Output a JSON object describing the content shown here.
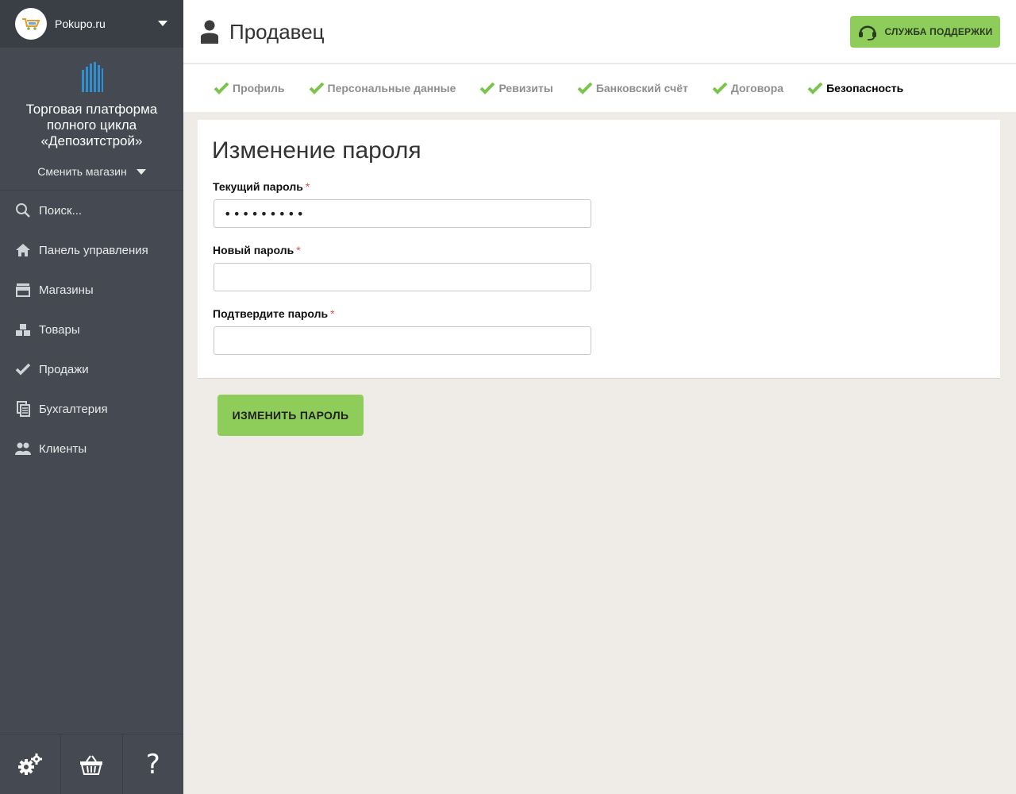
{
  "store": {
    "name": "Pokupo.ru"
  },
  "platform": {
    "name": "Торговая платформа полного цикла «Депозитстрой»",
    "switch_label": "Сменить магазин"
  },
  "nav": [
    {
      "label": "Поиск...",
      "icon": "search-icon"
    },
    {
      "label": "Панель управления",
      "icon": "home-icon"
    },
    {
      "label": "Магазины",
      "icon": "store-icon"
    },
    {
      "label": "Товары",
      "icon": "boxes-icon"
    },
    {
      "label": "Продажи",
      "icon": "check-icon"
    },
    {
      "label": "Бухгалтерия",
      "icon": "documents-icon"
    },
    {
      "label": "Клиенты",
      "icon": "users-icon"
    }
  ],
  "bottom_bar": {
    "help_glyph": "?"
  },
  "header": {
    "title": "Продавец",
    "support_label": "СЛУЖБА ПОДДЕРЖКИ"
  },
  "tabs": [
    {
      "label": "Профиль",
      "active": false
    },
    {
      "label": "Персональные данные",
      "active": false
    },
    {
      "label": "Ревизиты",
      "active": false
    },
    {
      "label": "Банковский счёт",
      "active": false
    },
    {
      "label": "Договора",
      "active": false
    },
    {
      "label": "Безопасность",
      "active": true
    }
  ],
  "form": {
    "title": "Изменение пароля",
    "current_password_label": "Текущий пароль",
    "current_password_value": "•••••••••",
    "new_password_label": "Новый пароль",
    "new_password_value": "",
    "confirm_password_label": "Подтвердите пароль",
    "confirm_password_value": "",
    "required_mark": "*",
    "submit_label": "ИЗМЕНИТЬ ПАРОЛЬ"
  },
  "colors": {
    "accent": "#8fcd5b",
    "sidebar": "#454a52",
    "required": "#e05252"
  }
}
